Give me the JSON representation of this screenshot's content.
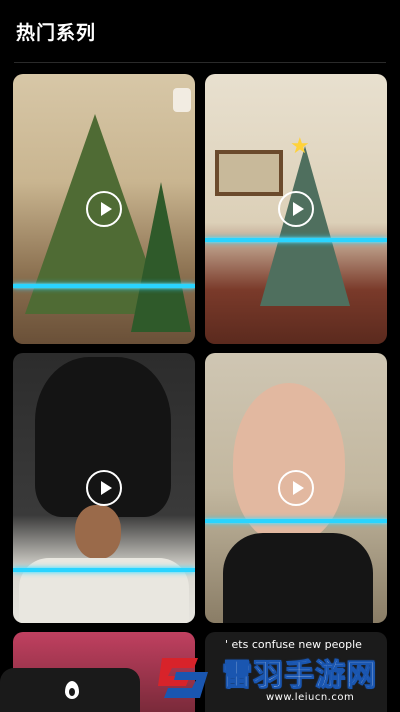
{
  "header": {
    "title": "热门系列"
  },
  "cards": [
    {
      "name": "tree-hair"
    },
    {
      "name": "tree-costume"
    },
    {
      "name": "tall-hair"
    },
    {
      "name": "bald-face"
    }
  ],
  "bottom_cards": [
    {
      "caption": ""
    },
    {
      "caption": "' ets confuse new people"
    }
  ],
  "tabbar": {
    "active_icon": "flame-icon"
  },
  "watermark": {
    "brand": "雷羽手游网",
    "url": "www.leiucn.com"
  },
  "colors": {
    "scanline": "#2ad4ff",
    "background": "#000000",
    "brand_blue": "#1a56b0",
    "brand_red": "#d8232a"
  }
}
